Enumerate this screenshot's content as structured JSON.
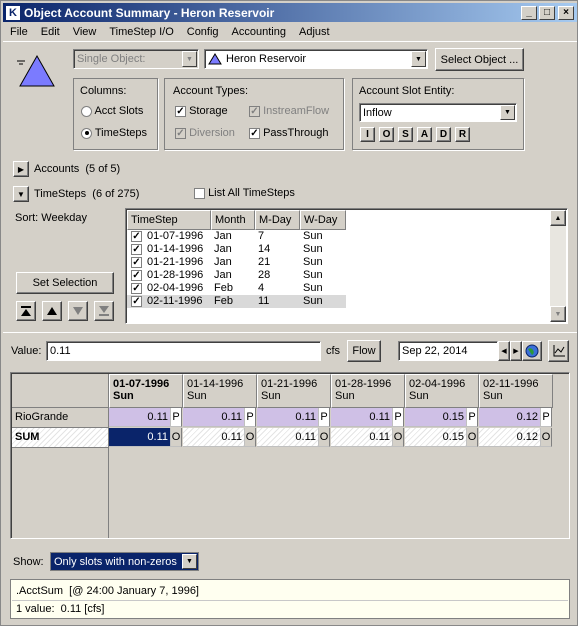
{
  "window": {
    "title": "Object Account Summary - Heron Reservoir"
  },
  "menu": [
    "File",
    "Edit",
    "View",
    "TimeStep I/O",
    "Config",
    "Accounting",
    "Adjust"
  ],
  "selector": {
    "mode": "Single Object:",
    "object": "Heron Reservoir",
    "select_button": "Select Object ..."
  },
  "columns": {
    "title": "Columns:",
    "options": [
      "Acct Slots",
      "TimeSteps"
    ],
    "selected": "TimeSteps"
  },
  "account_types": {
    "title": "Account Types:",
    "items": [
      {
        "label": "Storage",
        "checked": true,
        "enabled": true
      },
      {
        "label": "InstreamFlow",
        "checked": true,
        "enabled": false
      },
      {
        "label": "Diversion",
        "checked": true,
        "enabled": false
      },
      {
        "label": "PassThrough",
        "checked": true,
        "enabled": true
      }
    ]
  },
  "slot_entity": {
    "title": "Account Slot Entity:",
    "value": "Inflow",
    "buttons": [
      "I",
      "O",
      "S",
      "A",
      "D",
      "R"
    ]
  },
  "accounts_toggle": "Accounts  (5 of 5)",
  "timesteps_toggle": "TimeSteps  (6 of 275)",
  "list_all": "List All TimeSteps",
  "sort_label": "Sort: Weekday",
  "set_selection": "Set Selection",
  "timestep_table": {
    "headers": [
      "TimeStep",
      "Month",
      "M-Day",
      "W-Day"
    ],
    "rows": [
      {
        "date": "01-07-1996",
        "month": "Jan",
        "mday": "7",
        "wday": "Sun"
      },
      {
        "date": "01-14-1996",
        "month": "Jan",
        "mday": "14",
        "wday": "Sun"
      },
      {
        "date": "01-21-1996",
        "month": "Jan",
        "mday": "21",
        "wday": "Sun"
      },
      {
        "date": "01-28-1996",
        "month": "Jan",
        "mday": "28",
        "wday": "Sun"
      },
      {
        "date": "02-04-1996",
        "month": "Feb",
        "mday": "4",
        "wday": "Sun"
      },
      {
        "date": "02-11-1996",
        "month": "Feb",
        "mday": "11",
        "wday": "Sun"
      }
    ]
  },
  "value_bar": {
    "label": "Value:",
    "value": "0.11",
    "unit": "cfs",
    "flow_button": "Flow",
    "date": "Sep 22, 2014"
  },
  "grid": {
    "columns": [
      {
        "date": "01-07-1996",
        "day": "Sun"
      },
      {
        "date": "01-14-1996",
        "day": "Sun"
      },
      {
        "date": "01-21-1996",
        "day": "Sun"
      },
      {
        "date": "01-28-1996",
        "day": "Sun"
      },
      {
        "date": "02-04-1996",
        "day": "Sun"
      },
      {
        "date": "02-11-1996",
        "day": "Sun"
      }
    ],
    "rows": [
      {
        "name": "RioGrande",
        "values": [
          "0.11",
          "0.11",
          "0.11",
          "0.11",
          "0.15",
          "0.12"
        ],
        "flag": "P"
      },
      {
        "name": "SUM",
        "values": [
          "0.11",
          "0.11",
          "0.11",
          "0.11",
          "0.15",
          "0.12"
        ],
        "flag": "O"
      }
    ]
  },
  "show": {
    "label": "Show:",
    "value": "Only slots with non-zeros"
  },
  "status": {
    "line1": ".AcctSum  [@ 24:00 January 7, 1996]",
    "line2": "1 value:  0.11 [cfs]"
  },
  "colors": {
    "account_row": "#cfc0e6",
    "selected_cell": "#0a246a",
    "titlebar": "#0a246a"
  }
}
